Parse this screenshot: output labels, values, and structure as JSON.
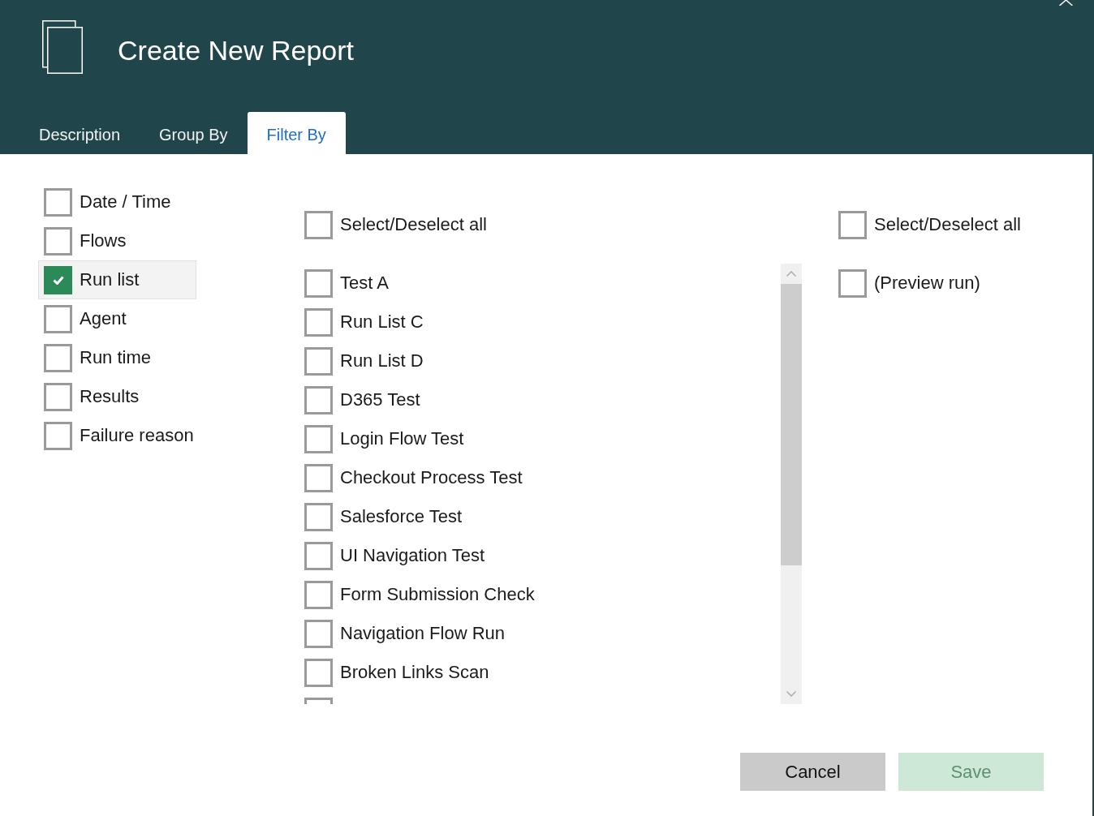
{
  "header": {
    "title": "Create New Report"
  },
  "tabs": [
    {
      "label": "Description",
      "selected": false
    },
    {
      "label": "Group By",
      "selected": false
    },
    {
      "label": "Filter By",
      "selected": true
    }
  ],
  "filter_fields": [
    {
      "label": "Date / Time",
      "checked": false,
      "selected": false
    },
    {
      "label": "Flows",
      "checked": false,
      "selected": false
    },
    {
      "label": "Run list",
      "checked": true,
      "selected": true
    },
    {
      "label": "Agent",
      "checked": false,
      "selected": false
    },
    {
      "label": "Run time",
      "checked": false,
      "selected": false
    },
    {
      "label": "Results",
      "checked": false,
      "selected": false
    },
    {
      "label": "Failure reason",
      "checked": false,
      "selected": false
    }
  ],
  "middle_list": {
    "select_all": {
      "label": "Select/Deselect all",
      "checked": false
    },
    "items": [
      {
        "label": "Test A",
        "checked": false
      },
      {
        "label": "Run List C",
        "checked": false
      },
      {
        "label": "Run List D",
        "checked": false
      },
      {
        "label": "D365 Test",
        "checked": false
      },
      {
        "label": "Login Flow Test",
        "checked": false
      },
      {
        "label": "Checkout Process Test",
        "checked": false
      },
      {
        "label": "Salesforce Test",
        "checked": false
      },
      {
        "label": "UI Navigation Test",
        "checked": false
      },
      {
        "label": "Form Submission Check",
        "checked": false
      },
      {
        "label": "Navigation Flow Run",
        "checked": false
      },
      {
        "label": "Broken Links Scan",
        "checked": false
      },
      {
        "checked": false
      }
    ]
  },
  "right_list": {
    "select_all": {
      "label": "Select/Deselect all",
      "checked": false
    },
    "items": [
      {
        "label": "(Preview run)",
        "checked": false
      }
    ]
  },
  "buttons": [
    {
      "label": "Cancel",
      "kind": "secondary",
      "disabled": false
    },
    {
      "label": "Save",
      "kind": "primary",
      "disabled": true
    }
  ]
}
